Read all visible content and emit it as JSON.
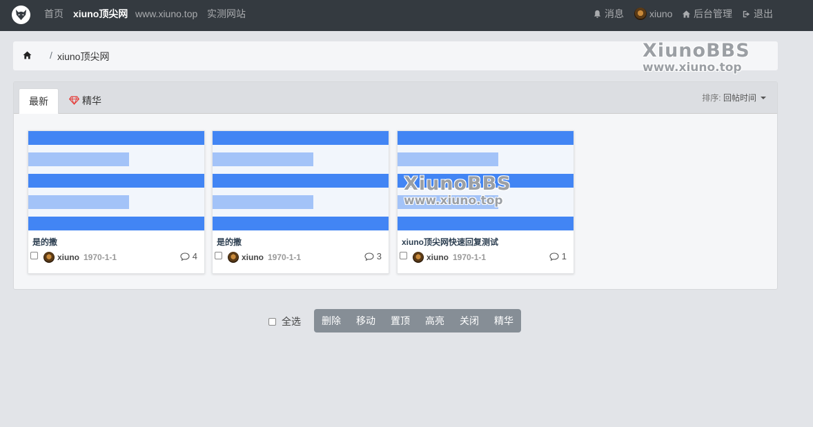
{
  "nav": {
    "links": [
      {
        "label": "首页"
      },
      {
        "label": "xiuno顶尖网"
      },
      {
        "label": "www.xiuno.top"
      },
      {
        "label": "实测网站"
      }
    ],
    "messages_label": "消息",
    "username": "xiuno",
    "admin_label": "后台管理",
    "logout_label": "退出"
  },
  "breadcrumb": {
    "home_icon": "home-icon",
    "separator": "/",
    "current": "xiuno顶尖网"
  },
  "watermark": {
    "line1": "XiunoBBS",
    "line2": "www.xiuno.top"
  },
  "tabs": {
    "latest": "最新",
    "digest": "精华"
  },
  "sort": {
    "label": "排序:",
    "value": "回帖时间"
  },
  "threads": [
    {
      "title": "是的撒",
      "user": "xiuno",
      "date": "1970-1-1",
      "replies": "4"
    },
    {
      "title": "是的撒",
      "user": "xiuno",
      "date": "1970-1-1",
      "replies": "3"
    },
    {
      "title": "xiuno顶尖网快速回复测试",
      "user": "xiuno",
      "date": "1970-1-1",
      "replies": "1"
    }
  ],
  "toolbar": {
    "select_all": "全选",
    "buttons": [
      "删除",
      "移动",
      "置顶",
      "高亮",
      "关闭",
      "精华"
    ]
  },
  "colors": {
    "navbar": "#343a40",
    "accent_blue": "#4285f4",
    "light_blue": "#a3c3f8",
    "button_gray": "#868e96",
    "gem_red": "#e53935"
  }
}
